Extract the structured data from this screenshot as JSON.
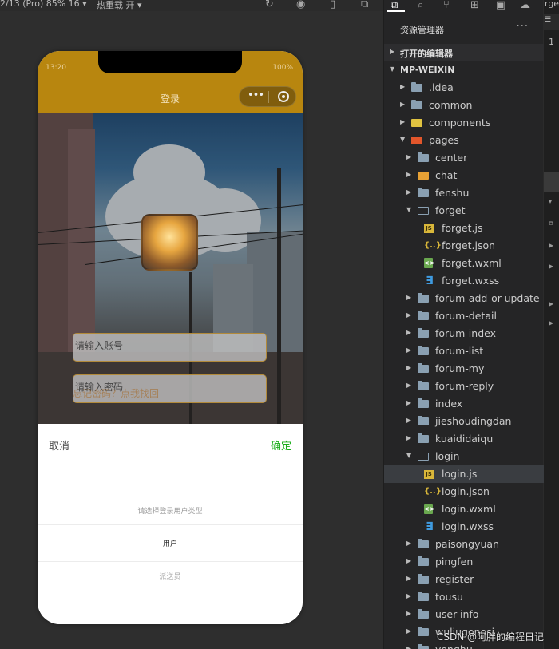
{
  "toolbar": {
    "device": "2/13 (Pro) 85% 16 ▾",
    "hot_reload": "热重载 开 ▾",
    "icons": [
      "refresh-icon",
      "stop-icon",
      "phone-icon",
      "window-icon"
    ]
  },
  "simulator": {
    "status_time": "13:20",
    "status_battery": "100%",
    "nav_title": "登录",
    "capsule_dots": "•••",
    "account_placeholder": "请输入账号",
    "password_placeholder": "请输入密码",
    "forgot_text": "忘记密码？点我找回",
    "sheet": {
      "cancel": "取消",
      "confirm": "确定",
      "hint": "请选择登录用户类型",
      "options": [
        "用户",
        "派送员"
      ]
    }
  },
  "explorer": {
    "title": "资源管理器",
    "more": "···",
    "open_editors": "打开的编辑器",
    "project": "MP-WEIXIN",
    "tree": [
      {
        "name": ".idea",
        "depth": 1,
        "type": "folder",
        "open": false
      },
      {
        "name": "common",
        "depth": 1,
        "type": "folder",
        "open": false
      },
      {
        "name": "components",
        "depth": 1,
        "type": "comp",
        "open": false
      },
      {
        "name": "pages",
        "depth": 1,
        "type": "pages",
        "open": true
      },
      {
        "name": "center",
        "depth": 2,
        "type": "folder",
        "open": false
      },
      {
        "name": "chat",
        "depth": 2,
        "type": "chat",
        "open": false
      },
      {
        "name": "fenshu",
        "depth": 2,
        "type": "folder",
        "open": false
      },
      {
        "name": "forget",
        "depth": 2,
        "type": "folder",
        "open": true
      },
      {
        "name": "forget.js",
        "depth": 3,
        "type": "js"
      },
      {
        "name": "forget.json",
        "depth": 3,
        "type": "json"
      },
      {
        "name": "forget.wxml",
        "depth": 3,
        "type": "wxml"
      },
      {
        "name": "forget.wxss",
        "depth": 3,
        "type": "wxss"
      },
      {
        "name": "forum-add-or-update",
        "depth": 2,
        "type": "folder",
        "open": false
      },
      {
        "name": "forum-detail",
        "depth": 2,
        "type": "folder",
        "open": false
      },
      {
        "name": "forum-index",
        "depth": 2,
        "type": "folder",
        "open": false
      },
      {
        "name": "forum-list",
        "depth": 2,
        "type": "folder",
        "open": false
      },
      {
        "name": "forum-my",
        "depth": 2,
        "type": "folder",
        "open": false
      },
      {
        "name": "forum-reply",
        "depth": 2,
        "type": "folder",
        "open": false
      },
      {
        "name": "index",
        "depth": 2,
        "type": "folder",
        "open": false
      },
      {
        "name": "jieshoudingdan",
        "depth": 2,
        "type": "folder",
        "open": false
      },
      {
        "name": "kuaididaiqu",
        "depth": 2,
        "type": "folder",
        "open": false
      },
      {
        "name": "login",
        "depth": 2,
        "type": "folder",
        "open": true
      },
      {
        "name": "login.js",
        "depth": 3,
        "type": "js",
        "selected": true
      },
      {
        "name": "login.json",
        "depth": 3,
        "type": "json"
      },
      {
        "name": "login.wxml",
        "depth": 3,
        "type": "wxml"
      },
      {
        "name": "login.wxss",
        "depth": 3,
        "type": "wxss"
      },
      {
        "name": "paisongyuan",
        "depth": 2,
        "type": "folder",
        "open": false
      },
      {
        "name": "pingfen",
        "depth": 2,
        "type": "folder",
        "open": false
      },
      {
        "name": "register",
        "depth": 2,
        "type": "folder",
        "open": false
      },
      {
        "name": "tousu",
        "depth": 2,
        "type": "folder",
        "open": false
      },
      {
        "name": "user-info",
        "depth": 2,
        "type": "folder",
        "open": false
      },
      {
        "name": "wuliugonosi",
        "depth": 2,
        "type": "folder",
        "open": false
      },
      {
        "name": "yonghu",
        "depth": 2,
        "type": "folder",
        "open": false
      }
    ]
  },
  "editor_edge": {
    "tab_fragment": "rge",
    "line_number": "1"
  },
  "watermark": "CSDN @阿胖的编程日记"
}
